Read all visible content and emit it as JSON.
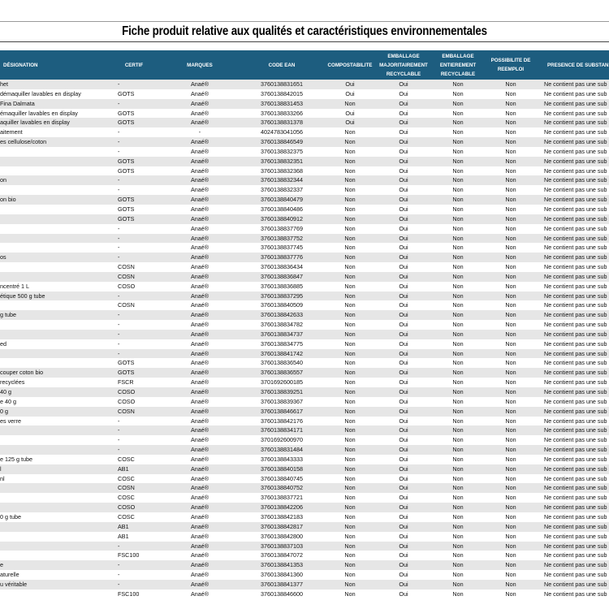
{
  "document": {
    "title": "Fiche produit relative aux qualités et caractéristiques environnementales"
  },
  "table": {
    "headers": {
      "designation": "DÉSIGNATION",
      "certif": "CERTIF",
      "marques": "MARQUES",
      "ean": "CODE EAN",
      "compostabilite": "COMPOSTABILITE",
      "emballage_maj": [
        "EMBALLAGE",
        "MAJORITAIREMENT",
        "RECYCLABLE"
      ],
      "emballage_ent": [
        "EMBALLAGE",
        "ENTIEREMENT",
        "RECYCLABLE"
      ],
      "possibilite": [
        "POSSIBILITE DE",
        "REEMPLOI"
      ],
      "presence": "PRESENCE DE SUBSTAN"
    },
    "rows": [
      [
        "het",
        "-",
        "Anaé®",
        "3760138831651",
        "Oui",
        "Oui",
        "Non",
        "Non",
        "Ne contient pas une sub"
      ],
      [
        "démaquiller lavables en display",
        "GOTS",
        "Anaé®",
        "3760138842015",
        "Oui",
        "Oui",
        "Non",
        "Non",
        "Ne contient pas une sub"
      ],
      [
        " Fina Dalmata",
        "-",
        "Anaé®",
        "3760138831453",
        "Non",
        "Oui",
        "Non",
        "Non",
        "Ne contient pas une sub"
      ],
      [
        "émaquiller lavables en display",
        "GOTS",
        "Anaé®",
        "3760138833266",
        "Oui",
        "Oui",
        "Non",
        "Non",
        "Ne contient pas une sub"
      ],
      [
        "aquiller lavables en display",
        "GOTS",
        "Anaé®",
        "3760138831378",
        "Oui",
        "Oui",
        "Non",
        "Non",
        "Ne contient pas une sub"
      ],
      [
        "aitement",
        "-",
        "-",
        "4024783041056",
        "Non",
        "Oui",
        "Non",
        "Non",
        "Ne contient pas une sub"
      ],
      [
        "es cellulose/coton",
        "-",
        "Anaé®",
        "3760138846549",
        "Non",
        "Oui",
        "Non",
        "Non",
        "Ne contient pas une sub"
      ],
      [
        "",
        "-",
        "Anaé®",
        "3760138832375",
        "Non",
        "Oui",
        "Non",
        "Non",
        "Ne contient pas une sub"
      ],
      [
        "",
        "GOTS",
        "Anaé®",
        "3760138832351",
        "Non",
        "Oui",
        "Non",
        "Non",
        "Ne contient pas une sub"
      ],
      [
        "",
        "GOTS",
        "Anaé®",
        "3760138832368",
        "Non",
        "Oui",
        "Non",
        "Non",
        "Ne contient pas une sub"
      ],
      [
        "on",
        "-",
        "Anaé®",
        "3760138832344",
        "Non",
        "Oui",
        "Non",
        "Non",
        "Ne contient pas une sub"
      ],
      [
        "",
        "-",
        "Anaé®",
        "3760138832337",
        "Non",
        "Oui",
        "Non",
        "Non",
        "Ne contient pas une sub"
      ],
      [
        "on bio",
        "GOTS",
        "Anaé®",
        "3760138840479",
        "Non",
        "Oui",
        "Non",
        "Non",
        "Ne contient pas une sub"
      ],
      [
        "",
        "GOTS",
        "Anaé®",
        "3760138840486",
        "Non",
        "Oui",
        "Non",
        "Non",
        "Ne contient pas une sub"
      ],
      [
        "",
        "GOTS",
        "Anaé®",
        "3760138840912",
        "Non",
        "Oui",
        "Non",
        "Non",
        "Ne contient pas une sub"
      ],
      [
        "",
        "-",
        "Anaé®",
        "3760138837769",
        "Non",
        "Oui",
        "Non",
        "Non",
        "Ne contient pas une sub"
      ],
      [
        "",
        "-",
        "Anaé®",
        "3760138837752",
        "Non",
        "Oui",
        "Non",
        "Non",
        "Ne contient pas une sub"
      ],
      [
        "",
        "-",
        "Anaé®",
        "3760138837745",
        "Non",
        "Oui",
        "Non",
        "Non",
        "Ne contient pas une sub"
      ],
      [
        "os",
        "-",
        "Anaé®",
        "3760138837776",
        "Non",
        "Oui",
        "Non",
        "Non",
        "Ne contient pas une sub"
      ],
      [
        "",
        "COSN",
        "Anaé®",
        "3760138836434",
        "Non",
        "Oui",
        "Non",
        "Non",
        "Ne contient pas une sub"
      ],
      [
        "",
        "COSN",
        "Anaé®",
        "3760138836847",
        "Non",
        "Oui",
        "Non",
        "Non",
        "Ne contient pas une sub"
      ],
      [
        "ncentré 1 L",
        "COSO",
        "Anaé®",
        "3760138836885",
        "Non",
        "Oui",
        "Non",
        "Non",
        "Ne contient pas une sub"
      ],
      [
        "étique 500 g tube",
        "-",
        "Anaé®",
        "3760138837295",
        "Non",
        "Oui",
        "Non",
        "Non",
        "Ne contient pas une sub"
      ],
      [
        "",
        "COSN",
        "Anaé®",
        "3760138840509",
        "Non",
        "Oui",
        "Non",
        "Non",
        "Ne contient pas une sub"
      ],
      [
        "g tube",
        "-",
        "Anaé®",
        "3760138842633",
        "Non",
        "Oui",
        "Non",
        "Non",
        "Ne contient pas une sub"
      ],
      [
        "",
        "-",
        "Anaé®",
        "3760138834782",
        "Non",
        "Oui",
        "Non",
        "Non",
        "Ne contient pas une sub"
      ],
      [
        "",
        "-",
        "Anaé®",
        "3760138834737",
        "Non",
        "Oui",
        "Non",
        "Non",
        "Ne contient pas une sub"
      ],
      [
        "ed",
        "-",
        "Anaé®",
        "3760138834775",
        "Non",
        "Oui",
        "Non",
        "Non",
        "Ne contient pas une sub"
      ],
      [
        "",
        "-",
        "Anaé®",
        "3760138841742",
        "Non",
        "Oui",
        "Non",
        "Non",
        "Ne contient pas une sub"
      ],
      [
        "",
        "GOTS",
        "Anaé®",
        "3760138836540",
        "Non",
        "Oui",
        "Non",
        "Non",
        "Ne contient pas une sub"
      ],
      [
        "couper coton bio",
        "GOTS",
        "Anaé®",
        "3760138836557",
        "Non",
        "Oui",
        "Non",
        "Non",
        "Ne contient pas une sub"
      ],
      [
        "recyclées",
        "FSCR",
        "Anaé®",
        "3701692600185",
        "Non",
        "Oui",
        "Non",
        "Non",
        "Ne contient pas une sub"
      ],
      [
        " 40 g",
        "COSO",
        "Anaé®",
        "3760138839251",
        "Non",
        "Oui",
        "Non",
        "Non",
        "Ne contient pas une sub"
      ],
      [
        "e 40 g",
        "COSO",
        "Anaé®",
        "3760138839367",
        "Non",
        "Oui",
        "Non",
        "Non",
        "Ne contient pas une sub"
      ],
      [
        "0 g",
        "COSN",
        "Anaé®",
        "3760138846617",
        "Non",
        "Oui",
        "Non",
        "Non",
        "Ne contient pas une sub"
      ],
      [
        "es verre",
        "-",
        "Anaé®",
        "3760138842176",
        "Non",
        "Oui",
        "Non",
        "Non",
        "Ne contient pas une sub"
      ],
      [
        "",
        "-",
        "Anaé®",
        "3760138834171",
        "Non",
        "Oui",
        "Non",
        "Non",
        "Ne contient pas une sub"
      ],
      [
        "",
        "-",
        "Anaé®",
        "3701692600970",
        "Non",
        "Oui",
        "Non",
        "Non",
        "Ne contient pas une sub"
      ],
      [
        "",
        "-",
        "Anaé®",
        "3760138831484",
        "Non",
        "Oui",
        "Non",
        "Non",
        "Ne contient pas une sub"
      ],
      [
        "e 125 g tube",
        "COSC",
        "Anaé®",
        "3760138843333",
        "Non",
        "Oui",
        "Non",
        "Non",
        "Ne contient pas une sub"
      ],
      [
        "l",
        "AB1",
        "Anaé®",
        "3760138840158",
        "Non",
        "Oui",
        "Non",
        "Non",
        "Ne contient pas une sub"
      ],
      [
        "nl",
        "COSC",
        "Anaé®",
        "3760138840745",
        "Non",
        "Oui",
        "Non",
        "Non",
        "Ne contient pas une sub"
      ],
      [
        "",
        "COSN",
        "Anaé®",
        "3760138840752",
        "Non",
        "Oui",
        "Non",
        "Non",
        "Ne contient pas une sub"
      ],
      [
        "",
        "COSC",
        "Anaé®",
        "3760138837721",
        "Non",
        "Oui",
        "Non",
        "Non",
        "Ne contient pas une sub"
      ],
      [
        "",
        "COSO",
        "Anaé®",
        "3760138842206",
        "Non",
        "Oui",
        "Non",
        "Non",
        "Ne contient pas une sub"
      ],
      [
        "0 g tube",
        "COSC",
        "Anaé®",
        "3760138842183",
        "Non",
        "Oui",
        "Non",
        "Non",
        "Ne contient pas une sub"
      ],
      [
        "",
        "AB1",
        "Anaé®",
        "3760138842817",
        "Non",
        "Oui",
        "Non",
        "Non",
        "Ne contient pas une sub"
      ],
      [
        "",
        "AB1",
        "Anaé®",
        "3760138842800",
        "Non",
        "Oui",
        "Non",
        "Non",
        "Ne contient pas une sub"
      ],
      [
        "",
        "-",
        "Anaé®",
        "3760138837103",
        "Non",
        "Oui",
        "Non",
        "Non",
        "Ne contient pas une sub"
      ],
      [
        "",
        "FSC100",
        "Anaé®",
        "3760138847072",
        "Non",
        "Oui",
        "Non",
        "Non",
        "Ne contient pas une sub"
      ],
      [
        "e",
        "-",
        "Anaé®",
        "3760138841353",
        "Non",
        "Oui",
        "Non",
        "Non",
        "Ne contient pas une sub"
      ],
      [
        "aturelle",
        "-",
        "Anaé®",
        "3760138841360",
        "Non",
        "Oui",
        "Non",
        "Non",
        "Ne contient pas une sub"
      ],
      [
        "u véritable",
        "-",
        "Anaé®",
        "3760138841377",
        "Non",
        "Oui",
        "Non",
        "Non",
        "Ne contient pas une sub"
      ],
      [
        "",
        "FSC100",
        "Anaé®",
        "3760138846600",
        "Non",
        "Oui",
        "Non",
        "Non",
        "Ne contient pas une sub"
      ]
    ]
  },
  "colors": {
    "header_bg": "#1d5d7f",
    "header_text": "#ffffff",
    "row_alt": "#e6e6e6"
  }
}
